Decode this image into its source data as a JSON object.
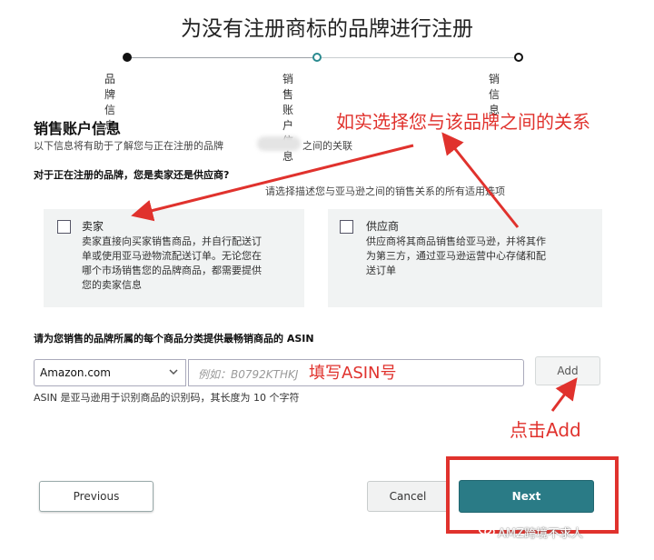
{
  "page_title": "为没有注册商标的品牌进行注册",
  "steps": [
    {
      "label": "品牌信息",
      "state": "done"
    },
    {
      "label": "销售账户信息",
      "state": "current"
    },
    {
      "label": "销信息",
      "state": "todo"
    }
  ],
  "section": {
    "heading": "销售账户信息",
    "subtitle_start": "以下信息将有助于了解您与正在注册的品牌",
    "subtitle_end": "之间的关联",
    "question": "对于正在注册的品牌，您是卖家还是供应商?",
    "hint": "请选择描述您与亚马逊之间的销售关系的所有适用选项"
  },
  "options": {
    "seller": {
      "title": "卖家",
      "desc_lines": [
        "卖家直接向买家销售商品，并自行配送订",
        "单或使用亚马逊物流配送订单。无论您在",
        "哪个市场销售您的品牌商品，都需要提供",
        "您的卖家信息"
      ]
    },
    "vendor": {
      "title": "供应商",
      "desc_lines": [
        "供应商将其商品销售给亚马逊，并将其作",
        "为第三方，通过亚马逊运营中心存储和配",
        "送订单"
      ]
    }
  },
  "asin": {
    "label": "请为您销售的品牌所属的每个商品分类提供最畅销商品的 ASIN",
    "marketplace_selected": "Amazon.com",
    "placeholder": "例如：B0792KTHKJ",
    "add_label": "Add",
    "help": "ASIN 是亚马逊用于识别商品的识别码，其长度为 10 个字符"
  },
  "buttons": {
    "previous": "Previous",
    "cancel": "Cancel",
    "next": "Next"
  },
  "annotations": {
    "relation": "如实选择您与该品牌之间的关系",
    "fill_asin": "填写ASIN号",
    "click_add": "点击Add"
  },
  "watermark": "AMZ跨境不求人",
  "colors": {
    "annotation": "#e0322d",
    "primary_button": "#2a7b86",
    "card_bg": "#f1f3f3"
  }
}
